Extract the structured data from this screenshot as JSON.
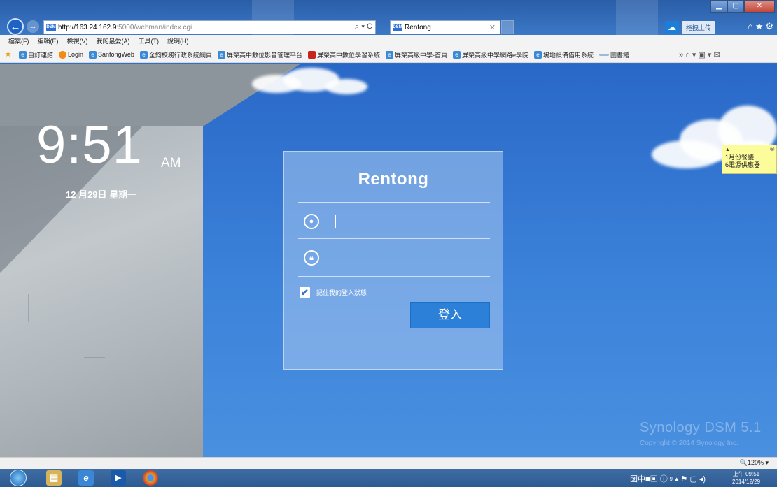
{
  "browser": {
    "address_host": "http://163.24.162.9",
    "address_rest": ":5000/webman/index.cgi",
    "address_icons": "⌕ ▾ C",
    "favicon_text": "DSM",
    "tab_title": "Rentong",
    "upload_label": "拖拽上传",
    "right_icons": "⌂★⚙",
    "menu": [
      "檔案(F)",
      "編輯(E)",
      "檢視(V)",
      "我的最愛(A)",
      "工具(T)",
      "說明(H)"
    ],
    "favorites": [
      {
        "label": "自訂連結",
        "icon": "page"
      },
      {
        "label": "Login",
        "icon": "orange"
      },
      {
        "label": "SanfongWeb",
        "icon": "page"
      },
      {
        "label": "全鈞校務行政系統網頁",
        "icon": "page"
      },
      {
        "label": "屏榮高中數位影音管理平台",
        "icon": "page"
      },
      {
        "label": "屏榮高中數位學習系統",
        "icon": "red"
      },
      {
        "label": "屏榮高級中學-首頁",
        "icon": "page"
      },
      {
        "label": "屏榮高級中學網路e學院",
        "icon": "page"
      },
      {
        "label": "場地設備借用系統",
        "icon": "page"
      },
      {
        "label": "圖書館",
        "icon": "dash"
      }
    ],
    "favbar_tools": "» ⌂ ▾ ▣ ▾ ✉"
  },
  "clock": {
    "time": "9:51",
    "ampm": "AM",
    "date": "12 月29日 星期一"
  },
  "login": {
    "title": "Rentong",
    "username_value": "",
    "password_value": "",
    "remember_label": "記住我的登入狀態",
    "remember_checked": true,
    "login_button": "登入"
  },
  "branding": {
    "product": "Synology DSM 5.1",
    "copyright": "Copyright © 2014 Synology Inc."
  },
  "tooltip": {
    "line1": "1月份餐議",
    "line2": "6電源供應器"
  },
  "statusbar": {
    "zoom": "🔍120% ▾"
  },
  "taskbar": {
    "tray": "图中■▣ ⓘ ᵍ ▴ ⚑ ▢ ◂)",
    "time": "上午 09:51",
    "date": "2014/12/29"
  }
}
